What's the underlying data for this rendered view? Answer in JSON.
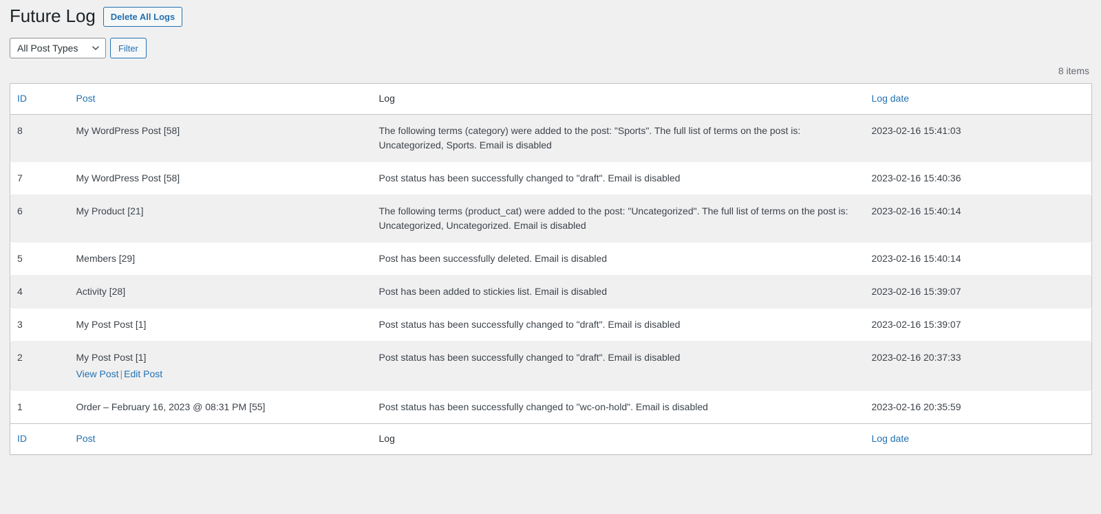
{
  "page": {
    "title": "Future Log",
    "delete_all_label": "Delete All Logs"
  },
  "filters": {
    "post_type_select": {
      "selected": "All Post Types",
      "icon": "chevron-down-icon"
    },
    "filter_button_label": "Filter"
  },
  "tablenav": {
    "items_count": "8 items"
  },
  "table": {
    "columns": [
      {
        "key": "id",
        "label": "ID",
        "sortable": true
      },
      {
        "key": "post",
        "label": "Post",
        "sortable": true
      },
      {
        "key": "log",
        "label": "Log",
        "sortable": false
      },
      {
        "key": "date",
        "label": "Log date",
        "sortable": true
      }
    ],
    "rows": [
      {
        "id": "8",
        "post": "My WordPress Post [58]",
        "log": "The following terms (category) were added to the post: \"Sports\". The full list of terms on the post is: Uncategorized, Sports. Email is disabled",
        "date": "2023-02-16 15:41:03",
        "actions": []
      },
      {
        "id": "7",
        "post": "My WordPress Post [58]",
        "log": "Post status has been successfully changed to \"draft\". Email is disabled",
        "date": "2023-02-16 15:40:36",
        "actions": []
      },
      {
        "id": "6",
        "post": "My Product [21]",
        "log": "The following terms (product_cat) were added to the post: \"Uncategorized\". The full list of terms on the post is: Uncategorized, Uncategorized. Email is disabled",
        "date": "2023-02-16 15:40:14",
        "actions": []
      },
      {
        "id": "5",
        "post": "Members [29]",
        "log": "Post has been successfully deleted. Email is disabled",
        "date": "2023-02-16 15:40:14",
        "actions": []
      },
      {
        "id": "4",
        "post": "Activity [28]",
        "log": "Post has been added to stickies list. Email is disabled",
        "date": "2023-02-16 15:39:07",
        "actions": []
      },
      {
        "id": "3",
        "post": "My Post Post [1]",
        "log": "Post status has been successfully changed to \"draft\". Email is disabled",
        "date": "2023-02-16 15:39:07",
        "actions": []
      },
      {
        "id": "2",
        "post": "My Post Post [1]",
        "log": "Post status has been successfully changed to \"draft\". Email is disabled",
        "date": "2023-02-16 20:37:33",
        "actions": [
          "View Post",
          "Edit Post"
        ]
      },
      {
        "id": "1",
        "post": "Order – February 16, 2023 @ 08:31 PM [55]",
        "log": "Post status has been successfully changed to \"wc-on-hold\". Email is disabled",
        "date": "2023-02-16 20:35:59",
        "actions": []
      }
    ]
  },
  "colors": {
    "link": "#2271b1",
    "page_bg": "#f0f0f1",
    "row_alt_bg": "#f0f0f1",
    "text": "#3c434a",
    "heading": "#1d2327",
    "border": "#c3c4c7"
  }
}
